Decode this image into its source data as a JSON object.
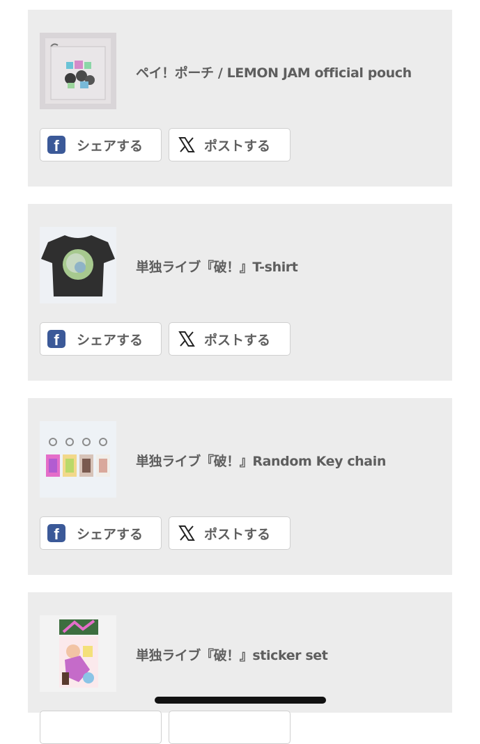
{
  "products": [
    {
      "title": "ペイ！ポーチ / LEMON JAM official pouch",
      "image": "pouch-image"
    },
    {
      "title": "単独ライブ『破！』T-shirt",
      "image": "tshirt-image"
    },
    {
      "title": "単独ライブ『破！』Random Key chain",
      "image": "keychain-image"
    },
    {
      "title": "単独ライブ『破！』sticker set",
      "image": "sticker-image"
    }
  ],
  "share": {
    "facebook_label": "シェアする",
    "x_label": "ポストする"
  },
  "colors": {
    "card_bg": "#ececec",
    "text": "#5e5e5e",
    "facebook": "#3b5998"
  }
}
